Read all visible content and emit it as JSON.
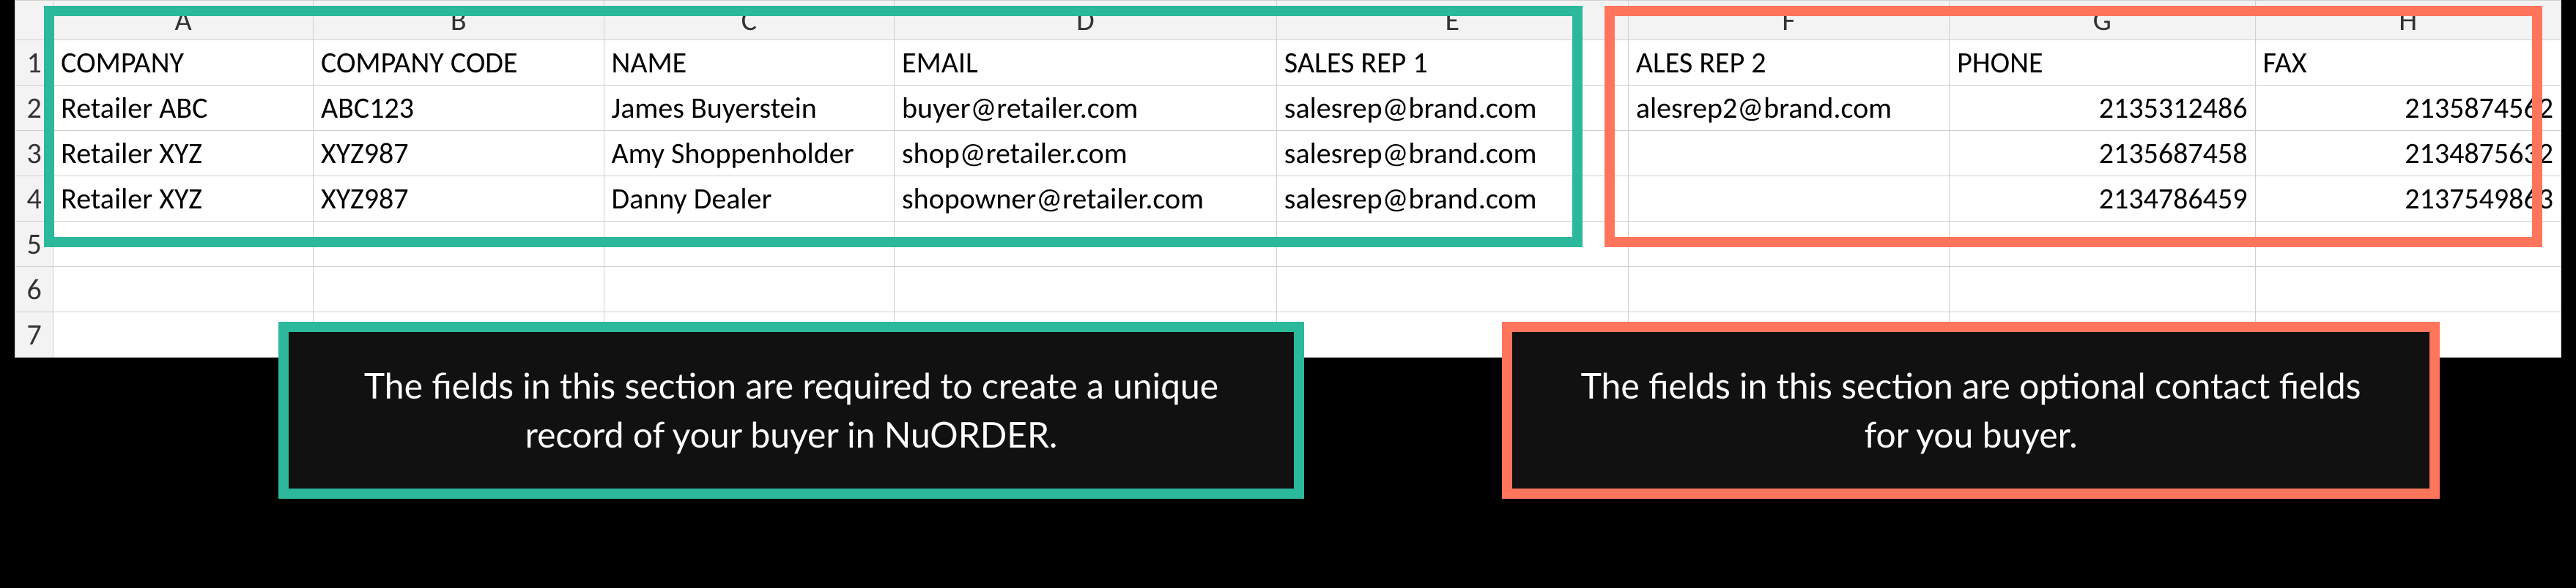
{
  "columns": [
    "A",
    "B",
    "C",
    "D",
    "E",
    "F",
    "G",
    "H"
  ],
  "rowNumbers": [
    "1",
    "2",
    "3",
    "4",
    "5",
    "6",
    "7"
  ],
  "headers": {
    "A": "COMPANY",
    "B": "COMPANY CODE",
    "C": "NAME",
    "D": "EMAIL",
    "E": "SALES REP 1",
    "F": "ALES REP 2",
    "G": "PHONE",
    "H": "FAX"
  },
  "rows": [
    {
      "A": "Retailer ABC",
      "B": "ABC123",
      "C": "James Buyerstein",
      "D": "buyer@retailer.com",
      "E": "salesrep@brand.com",
      "F": "alesrep2@brand.com",
      "G": "2135312486",
      "H": "2135874562"
    },
    {
      "A": "Retailer XYZ",
      "B": "XYZ987",
      "C": "Amy Shoppenholder",
      "D": "shop@retailer.com",
      "E": "salesrep@brand.com",
      "F": "",
      "G": "2135687458",
      "H": "2134875632"
    },
    {
      "A": "Retailer XYZ",
      "B": "XYZ987",
      "C": "Danny Dealer",
      "D": "shopowner@retailer.com",
      "E": "salesrep@brand.com",
      "F": "",
      "G": "2134786459",
      "H": "2137549863"
    }
  ],
  "callouts": {
    "green": "The fields in this section are required to create a unique record of your buyer in NuORDER.",
    "orange": "The fields in this section are optional contact fields for you buyer."
  }
}
